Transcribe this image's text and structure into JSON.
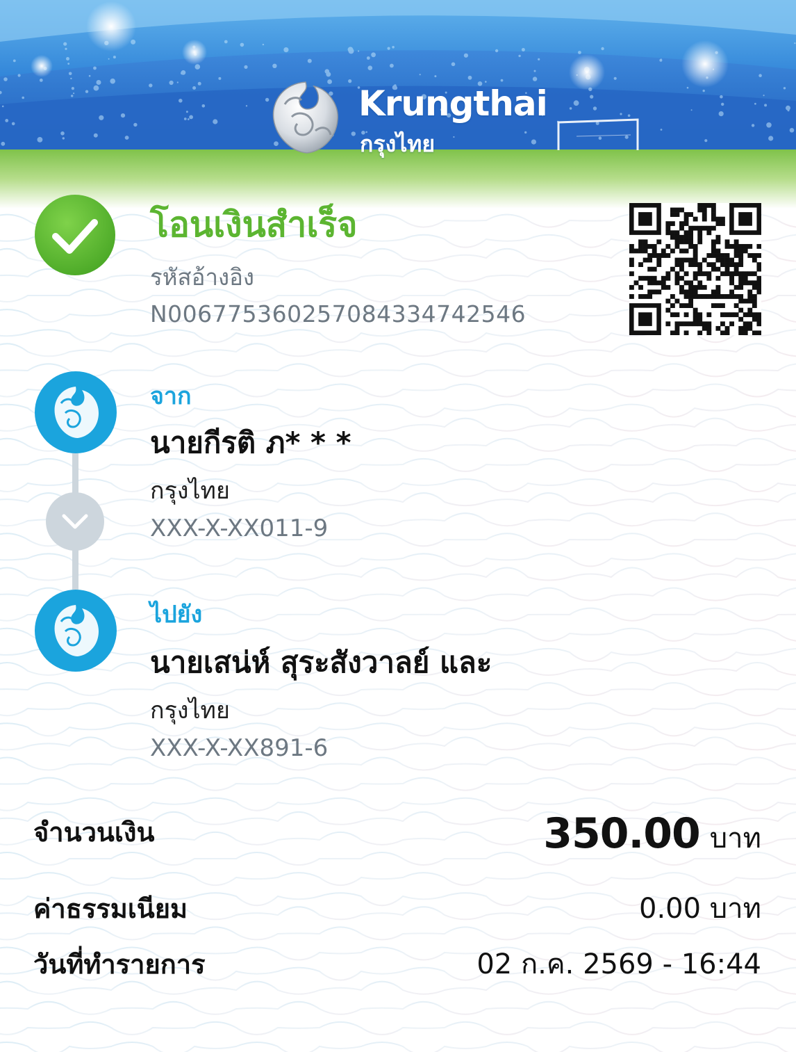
{
  "brand": {
    "name_en": "Krungthai",
    "name_th": "กรุงไทย",
    "colors": {
      "primary": "#1ba4dd",
      "success": "#5cb531",
      "muted": "#6d7882"
    }
  },
  "status": {
    "icon": "check-circle-icon",
    "title": "โอนเงินสำเร็จ",
    "reference_label": "รหัสอ้างอิง",
    "reference_value": "N006775360257084334742546"
  },
  "qr_code": {
    "icon": "qr-code-icon"
  },
  "from": {
    "role_label": "จาก",
    "name": "นายกีรติ ภ* * *",
    "bank": "กรุงไทย",
    "account": "XXX-X-XX011-9",
    "icon": "krungthai-bank-icon"
  },
  "connector": {
    "icon": "chevron-down-icon"
  },
  "to": {
    "role_label": "ไปยัง",
    "name": "นายเสน่ห์ สุระสังวาลย์ และ",
    "bank": "กรุงไทย",
    "account": "XXX-X-XX891-6",
    "icon": "krungthai-bank-icon"
  },
  "summary": {
    "amount_label": "จำนวนเงิน",
    "amount_value": "350.00",
    "amount_unit": "บาท",
    "fee_label": "ค่าธรรมเนียม",
    "fee_value": "0.00 บาท",
    "date_label": "วันที่ทำรายการ",
    "date_value": "02 ก.ค. 2569 - 16:44"
  }
}
